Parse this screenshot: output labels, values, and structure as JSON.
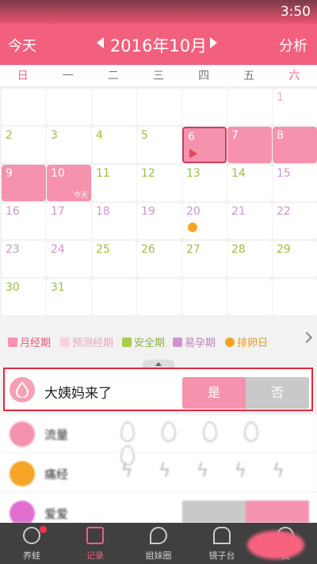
{
  "status_bar": {
    "time": "3:50"
  },
  "header": {
    "today_label": "今天",
    "month": "2016年10月",
    "analysis_label": "分析"
  },
  "weekdays": [
    "日",
    "一",
    "二",
    "三",
    "四",
    "五",
    "六"
  ],
  "calendar": {
    "days": [
      {
        "n": "1",
        "t": "pred",
        "r": 0,
        "c": 6
      },
      {
        "n": "2",
        "t": "safe",
        "r": 1,
        "c": 0
      },
      {
        "n": "3",
        "t": "safe",
        "r": 1,
        "c": 1
      },
      {
        "n": "4",
        "t": "safe",
        "r": 1,
        "c": 2
      },
      {
        "n": "5",
        "t": "safe",
        "r": 1,
        "c": 3
      },
      {
        "n": "6",
        "t": "period",
        "r": 1,
        "c": 4
      },
      {
        "n": "7",
        "t": "period",
        "r": 1,
        "c": 5
      },
      {
        "n": "8",
        "t": "period",
        "r": 1,
        "c": 6
      },
      {
        "n": "9",
        "t": "period",
        "r": 2,
        "c": 0
      },
      {
        "n": "10",
        "t": "period",
        "r": 2,
        "c": 1
      },
      {
        "n": "11",
        "t": "safe",
        "r": 2,
        "c": 2
      },
      {
        "n": "12",
        "t": "safe",
        "r": 2,
        "c": 3
      },
      {
        "n": "13",
        "t": "safe",
        "r": 2,
        "c": 4
      },
      {
        "n": "14",
        "t": "safe",
        "r": 2,
        "c": 5
      },
      {
        "n": "15",
        "t": "fert",
        "r": 2,
        "c": 6
      },
      {
        "n": "16",
        "t": "fert",
        "r": 3,
        "c": 0
      },
      {
        "n": "17",
        "t": "fert",
        "r": 3,
        "c": 1
      },
      {
        "n": "18",
        "t": "fert",
        "r": 3,
        "c": 2
      },
      {
        "n": "19",
        "t": "fert",
        "r": 3,
        "c": 3
      },
      {
        "n": "20",
        "t": "fert",
        "r": 3,
        "c": 4
      },
      {
        "n": "21",
        "t": "fert",
        "r": 3,
        "c": 5
      },
      {
        "n": "22",
        "t": "fert",
        "r": 3,
        "c": 6
      },
      {
        "n": "23",
        "t": "fert",
        "r": 4,
        "c": 0
      },
      {
        "n": "24",
        "t": "fert",
        "r": 4,
        "c": 1
      },
      {
        "n": "25",
        "t": "safe",
        "r": 4,
        "c": 2
      },
      {
        "n": "26",
        "t": "safe",
        "r": 4,
        "c": 3
      },
      {
        "n": "27",
        "t": "safe",
        "r": 4,
        "c": 4
      },
      {
        "n": "28",
        "t": "safe",
        "r": 4,
        "c": 5
      },
      {
        "n": "29",
        "t": "safe",
        "r": 4,
        "c": 6
      },
      {
        "n": "30",
        "t": "safe",
        "r": 5,
        "c": 0
      },
      {
        "n": "31",
        "t": "safe",
        "r": 5,
        "c": 1
      }
    ],
    "empty_slots": [
      [
        0,
        0
      ],
      [
        0,
        1
      ],
      [
        0,
        2
      ],
      [
        0,
        3
      ],
      [
        0,
        4
      ],
      [
        0,
        5
      ],
      [
        5,
        2
      ],
      [
        5,
        3
      ],
      [
        5,
        4
      ],
      [
        5,
        5
      ],
      [
        5,
        6
      ]
    ],
    "today_tag": "今天",
    "selected_day": "6",
    "ovulation_day": "20"
  },
  "legend": {
    "items": [
      {
        "label": "月经期",
        "color": "#f592ad"
      },
      {
        "label": "预测经期",
        "color": "#f9d2de"
      },
      {
        "label": "安全期",
        "color": "#a8cf4a"
      },
      {
        "label": "易孕期",
        "color": "#cf94cf"
      },
      {
        "label": "排卵日",
        "color": "#f5a424"
      }
    ]
  },
  "period_question": {
    "label": "大姨妈来了",
    "yes": "是",
    "no": "否"
  },
  "records": [
    {
      "label": "流量",
      "icon": "flow-icon",
      "color": "#f592ad"
    },
    {
      "label": "痛经",
      "icon": "cramps-icon",
      "color": "#f5a424"
    },
    {
      "label": "爱爱",
      "icon": "love-icon",
      "color": "#e06fd0"
    }
  ],
  "tabs": [
    {
      "label": "养蛙",
      "icon": "frog-icon",
      "badge": true
    },
    {
      "label": "记录",
      "icon": "calendar-icon",
      "active": true
    },
    {
      "label": "姐妹圈",
      "icon": "community-icon"
    },
    {
      "label": "镜子台",
      "icon": "mirror-icon"
    },
    {
      "label": "我",
      "icon": "profile-icon"
    }
  ]
}
